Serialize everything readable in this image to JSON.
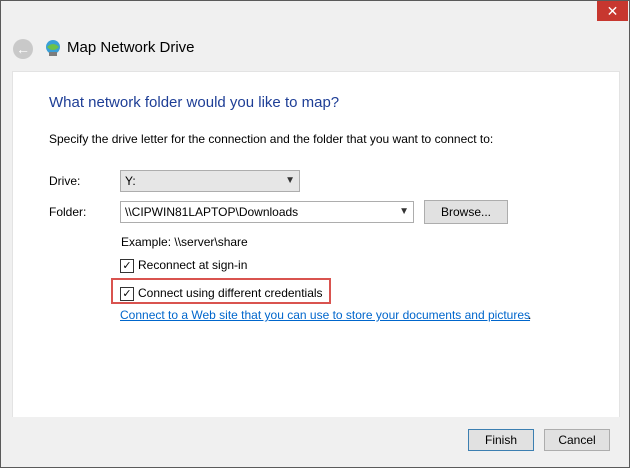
{
  "window": {
    "title": "Map Network Drive",
    "close_glyph": "✕",
    "back_glyph": "←"
  },
  "main": {
    "heading": "What network folder would you like to map?",
    "instructions": "Specify the drive letter for the connection and the folder that you want to connect to:",
    "drive_label": "Drive:",
    "drive_value": "Y:",
    "folder_label": "Folder:",
    "folder_value": "\\\\CIPWIN81LAPTOP\\Downloads",
    "browse_label": "Browse...",
    "example_text": "Example: \\\\server\\share",
    "reconnect_label": "Reconnect at sign-in",
    "reconnect_checked": "✓",
    "credentials_label": "Connect using different credentials",
    "credentials_checked": "✓",
    "link_text": "Connect to a Web site that you can use to store your documents and pictures",
    "link_suffix": "."
  },
  "footer": {
    "finish_label": "Finish",
    "cancel_label": "Cancel"
  },
  "colors": {
    "heading": "#1e3e96",
    "link": "#0066cc",
    "close_button": "#c7372f",
    "highlight_box": "#d9534f"
  },
  "icons": [
    "back-arrow-icon",
    "network-drive-icon",
    "close-icon",
    "chevron-down-icon",
    "checkmark-icon"
  ]
}
